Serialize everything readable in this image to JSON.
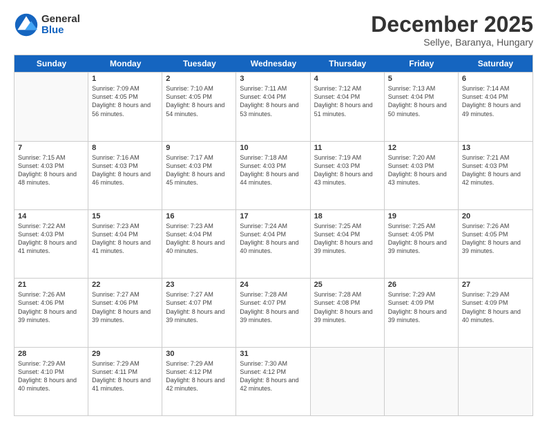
{
  "header": {
    "logo": {
      "general": "General",
      "blue": "Blue"
    },
    "month": "December 2025",
    "location": "Sellye, Baranya, Hungary"
  },
  "weekdays": [
    "Sunday",
    "Monday",
    "Tuesday",
    "Wednesday",
    "Thursday",
    "Friday",
    "Saturday"
  ],
  "weeks": [
    [
      {
        "day": "",
        "empty": true
      },
      {
        "day": "1",
        "sunrise": "7:09 AM",
        "sunset": "4:05 PM",
        "daylight": "8 hours and 56 minutes."
      },
      {
        "day": "2",
        "sunrise": "7:10 AM",
        "sunset": "4:05 PM",
        "daylight": "8 hours and 54 minutes."
      },
      {
        "day": "3",
        "sunrise": "7:11 AM",
        "sunset": "4:04 PM",
        "daylight": "8 hours and 53 minutes."
      },
      {
        "day": "4",
        "sunrise": "7:12 AM",
        "sunset": "4:04 PM",
        "daylight": "8 hours and 51 minutes."
      },
      {
        "day": "5",
        "sunrise": "7:13 AM",
        "sunset": "4:04 PM",
        "daylight": "8 hours and 50 minutes."
      },
      {
        "day": "6",
        "sunrise": "7:14 AM",
        "sunset": "4:04 PM",
        "daylight": "8 hours and 49 minutes."
      }
    ],
    [
      {
        "day": "7",
        "sunrise": "7:15 AM",
        "sunset": "4:03 PM",
        "daylight": "8 hours and 48 minutes."
      },
      {
        "day": "8",
        "sunrise": "7:16 AM",
        "sunset": "4:03 PM",
        "daylight": "8 hours and 46 minutes."
      },
      {
        "day": "9",
        "sunrise": "7:17 AM",
        "sunset": "4:03 PM",
        "daylight": "8 hours and 45 minutes."
      },
      {
        "day": "10",
        "sunrise": "7:18 AM",
        "sunset": "4:03 PM",
        "daylight": "8 hours and 44 minutes."
      },
      {
        "day": "11",
        "sunrise": "7:19 AM",
        "sunset": "4:03 PM",
        "daylight": "8 hours and 43 minutes."
      },
      {
        "day": "12",
        "sunrise": "7:20 AM",
        "sunset": "4:03 PM",
        "daylight": "8 hours and 43 minutes."
      },
      {
        "day": "13",
        "sunrise": "7:21 AM",
        "sunset": "4:03 PM",
        "daylight": "8 hours and 42 minutes."
      }
    ],
    [
      {
        "day": "14",
        "sunrise": "7:22 AM",
        "sunset": "4:03 PM",
        "daylight": "8 hours and 41 minutes."
      },
      {
        "day": "15",
        "sunrise": "7:23 AM",
        "sunset": "4:04 PM",
        "daylight": "8 hours and 41 minutes."
      },
      {
        "day": "16",
        "sunrise": "7:23 AM",
        "sunset": "4:04 PM",
        "daylight": "8 hours and 40 minutes."
      },
      {
        "day": "17",
        "sunrise": "7:24 AM",
        "sunset": "4:04 PM",
        "daylight": "8 hours and 40 minutes."
      },
      {
        "day": "18",
        "sunrise": "7:25 AM",
        "sunset": "4:04 PM",
        "daylight": "8 hours and 39 minutes."
      },
      {
        "day": "19",
        "sunrise": "7:25 AM",
        "sunset": "4:05 PM",
        "daylight": "8 hours and 39 minutes."
      },
      {
        "day": "20",
        "sunrise": "7:26 AM",
        "sunset": "4:05 PM",
        "daylight": "8 hours and 39 minutes."
      }
    ],
    [
      {
        "day": "21",
        "sunrise": "7:26 AM",
        "sunset": "4:06 PM",
        "daylight": "8 hours and 39 minutes."
      },
      {
        "day": "22",
        "sunrise": "7:27 AM",
        "sunset": "4:06 PM",
        "daylight": "8 hours and 39 minutes."
      },
      {
        "day": "23",
        "sunrise": "7:27 AM",
        "sunset": "4:07 PM",
        "daylight": "8 hours and 39 minutes."
      },
      {
        "day": "24",
        "sunrise": "7:28 AM",
        "sunset": "4:07 PM",
        "daylight": "8 hours and 39 minutes."
      },
      {
        "day": "25",
        "sunrise": "7:28 AM",
        "sunset": "4:08 PM",
        "daylight": "8 hours and 39 minutes."
      },
      {
        "day": "26",
        "sunrise": "7:29 AM",
        "sunset": "4:09 PM",
        "daylight": "8 hours and 39 minutes."
      },
      {
        "day": "27",
        "sunrise": "7:29 AM",
        "sunset": "4:09 PM",
        "daylight": "8 hours and 40 minutes."
      }
    ],
    [
      {
        "day": "28",
        "sunrise": "7:29 AM",
        "sunset": "4:10 PM",
        "daylight": "8 hours and 40 minutes."
      },
      {
        "day": "29",
        "sunrise": "7:29 AM",
        "sunset": "4:11 PM",
        "daylight": "8 hours and 41 minutes."
      },
      {
        "day": "30",
        "sunrise": "7:29 AM",
        "sunset": "4:12 PM",
        "daylight": "8 hours and 42 minutes."
      },
      {
        "day": "31",
        "sunrise": "7:30 AM",
        "sunset": "4:12 PM",
        "daylight": "8 hours and 42 minutes."
      },
      {
        "day": "",
        "empty": true
      },
      {
        "day": "",
        "empty": true
      },
      {
        "day": "",
        "empty": true
      }
    ]
  ]
}
